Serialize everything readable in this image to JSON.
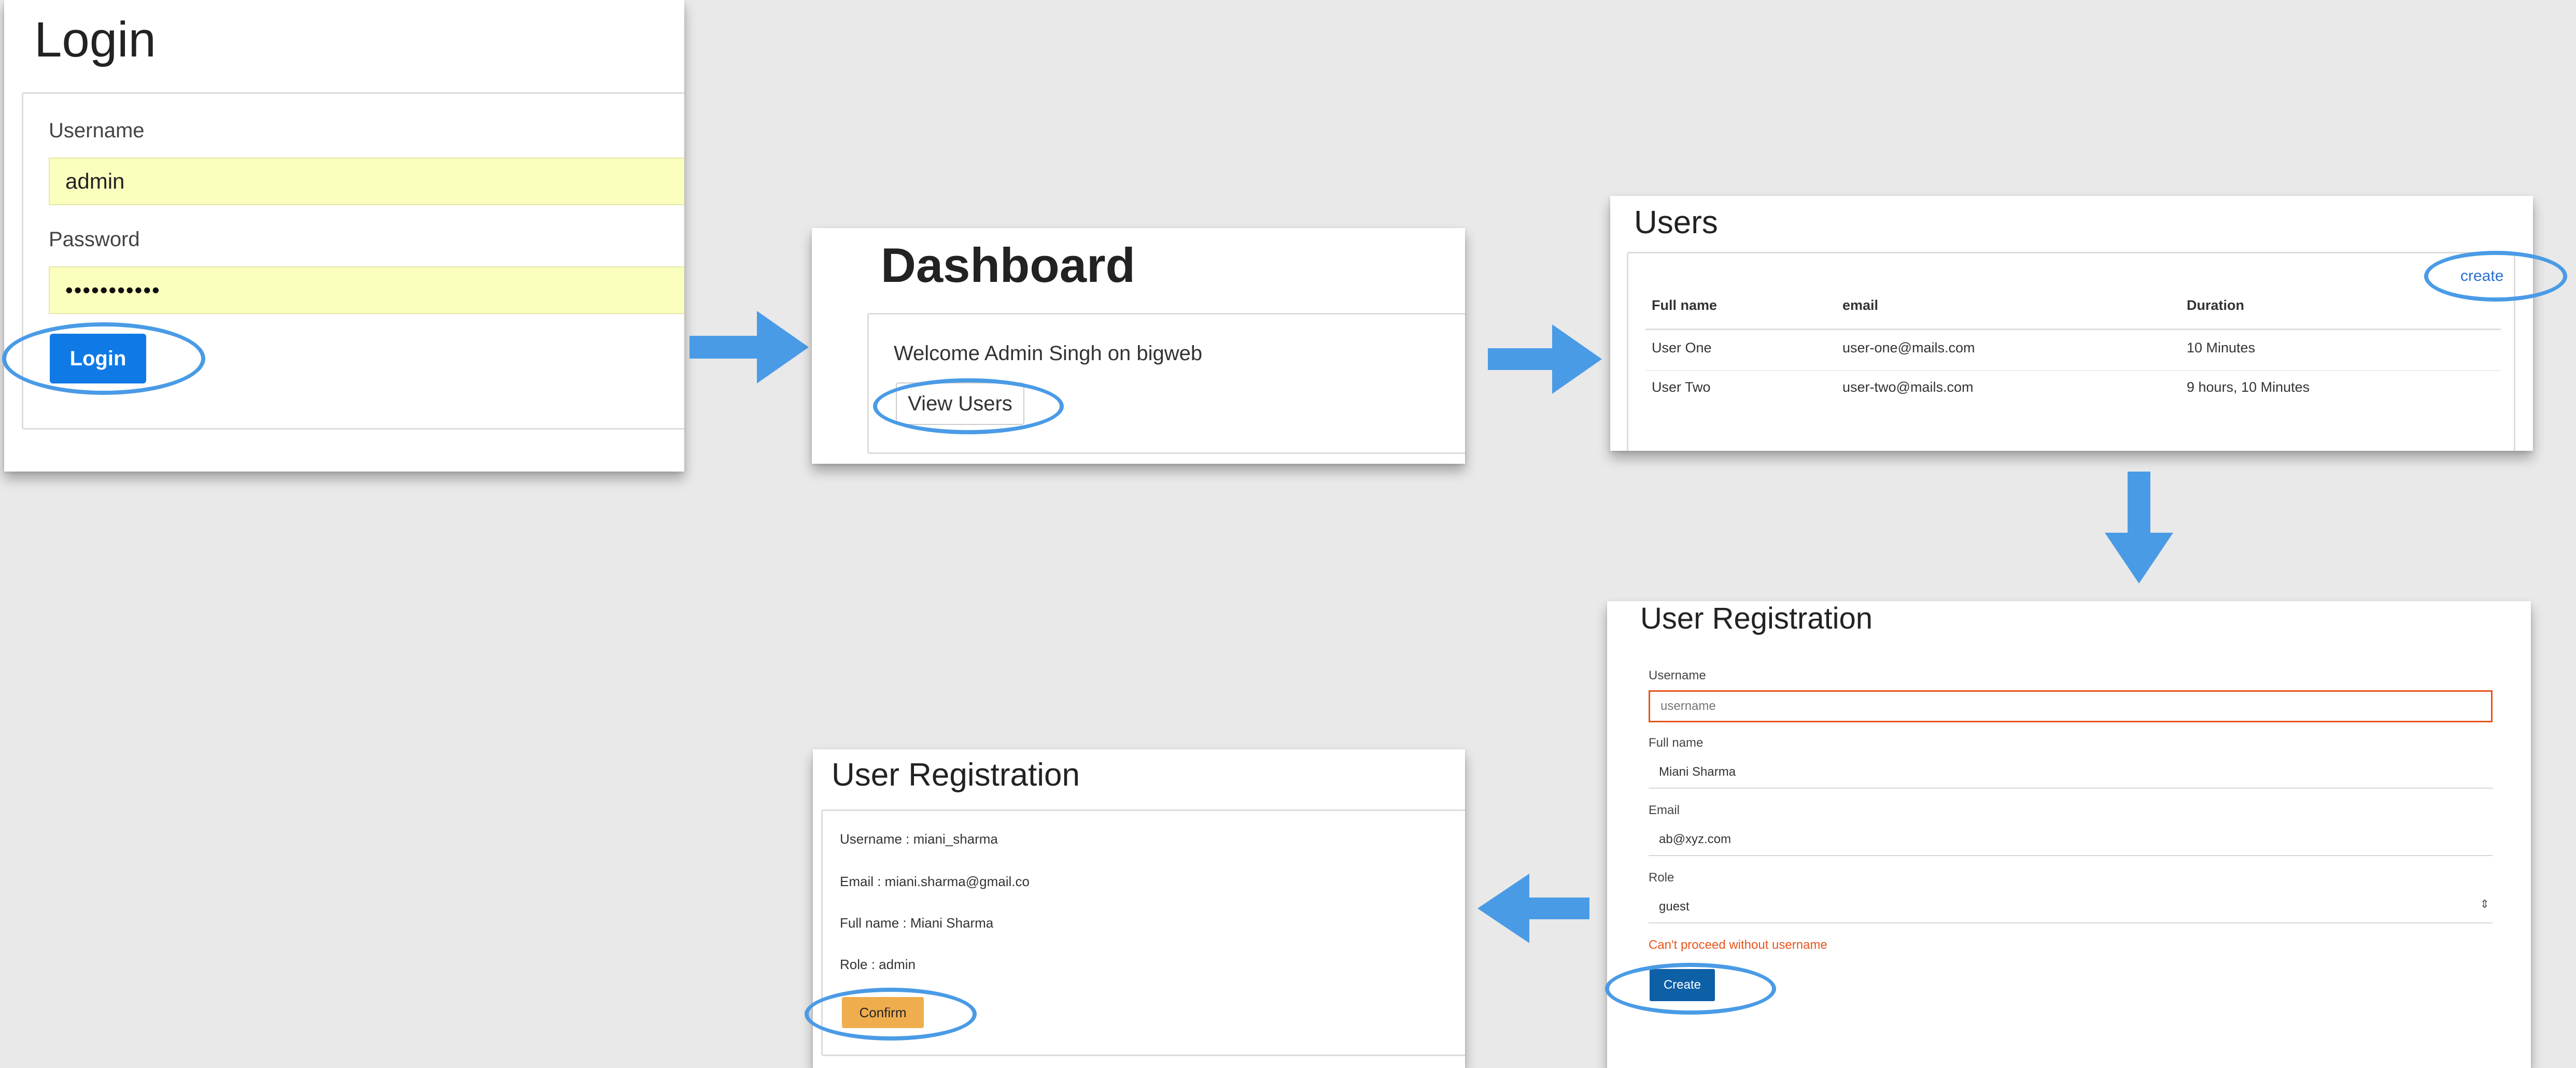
{
  "login": {
    "title": "Login",
    "username_label": "Username",
    "username_value": "admin",
    "password_label": "Password",
    "password_value": "•••••••••••",
    "submit_label": "Login"
  },
  "dashboard": {
    "title": "Dashboard",
    "welcome": "Welcome Admin Singh on bigweb",
    "view_users_label": "View Users"
  },
  "users": {
    "title": "Users",
    "create_link": "create",
    "columns": [
      "Full name",
      "email",
      "Duration"
    ],
    "rows": [
      [
        "User One",
        "user-one@mails.com",
        "10 Minutes"
      ],
      [
        "User Two",
        "user-two@mails.com",
        "9 hours, 10 Minutes"
      ]
    ]
  },
  "registration_form": {
    "title": "User Registration",
    "username_label": "Username",
    "username_placeholder": "username",
    "fullname_label": "Full name",
    "fullname_value": "Miani Sharma",
    "email_label": "Email",
    "email_value": "ab@xyz.com",
    "role_label": "Role",
    "role_value": "guest",
    "error": "Can't proceed without username",
    "create_label": "Create"
  },
  "registration_confirm": {
    "title": "User Registration",
    "username_line": "Username : miani_sharma",
    "email_line": "Email : miani.sharma@gmail.co",
    "fullname_line": "Full name : Miani Sharma",
    "role_line": "Role : admin",
    "confirm_label": "Confirm"
  },
  "colors": {
    "background": "#e9e9e9",
    "highlight_ring": "#4a9be6",
    "flow_arrow": "#4a9be6",
    "primary_button": "#0f7ae5",
    "create_button": "#0d5fa6",
    "confirm_button": "#f0ad4e",
    "autofill_yellow": "#faffbd",
    "error_text": "#e8541c",
    "link": "#2a6fd1"
  }
}
